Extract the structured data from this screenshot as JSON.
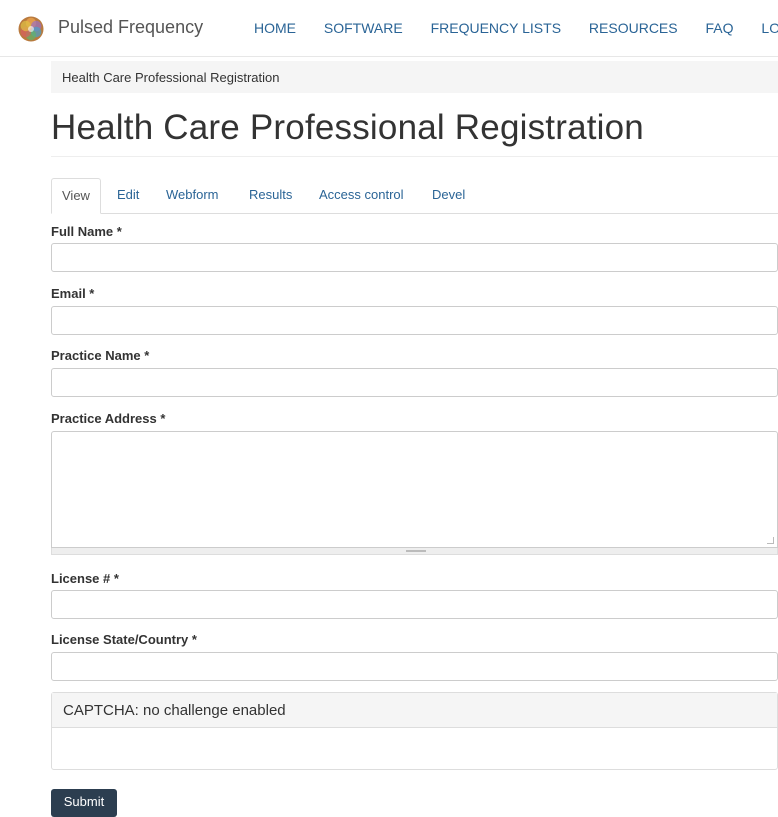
{
  "navbar": {
    "brand": "Pulsed Frequency",
    "links": [
      "HOME",
      "SOFTWARE",
      "FREQUENCY LISTS",
      "RESOURCES",
      "FAQ",
      "LOGOUT"
    ]
  },
  "breadcrumb": "Health Care Professional Registration",
  "page_title": "Health Care Professional Registration",
  "tabs": [
    "View",
    "Edit",
    "Webform",
    "Results",
    "Access control",
    "Devel"
  ],
  "form": {
    "full_name_label": "Full Name *",
    "email_label": "Email *",
    "practice_name_label": "Practice Name *",
    "practice_address_label": "Practice Address *",
    "license_label": "License # *",
    "license_state_label": "License State/Country *",
    "captcha_heading": "CAPTCHA: no challenge enabled",
    "submit_label": "Submit"
  },
  "colors": {
    "link": "#2a6496",
    "button": "#2c3e50",
    "panel_bg": "#f5f5f5"
  }
}
